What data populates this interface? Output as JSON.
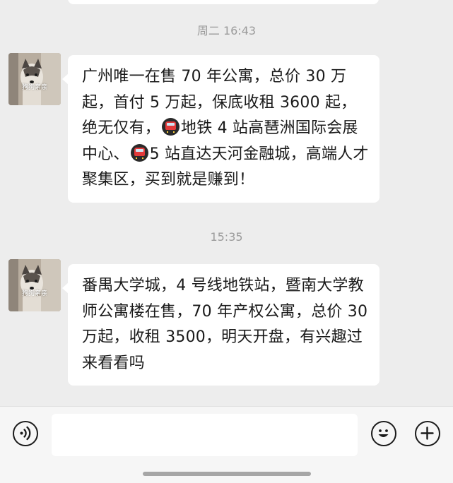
{
  "chat": {
    "messages": [
      {
        "time": "周二 16:43",
        "sender": "狗狗亲亲",
        "segments": [
          "广州唯一在售 70 年公寓，总价 30 万起，首付 5 万起，保底收租 3600 起，绝无仅有，",
          "地铁 4 站高琶洲国际会展中心、",
          "5 站直达天河金融城，高端人才聚集区，买到就是赚到！"
        ]
      },
      {
        "time": "15:35",
        "sender": "狗狗亲亲",
        "segments": [
          "番禺大学城，4 号线地铁站，暨南大学教师公寓楼在售，70 年产权公寓，总价 30 万起，收租 3500，明天开盘，有兴趣过来看看吗"
        ]
      }
    ]
  },
  "composer": {
    "input_value": "",
    "icons": [
      "voice-icon",
      "emoji-icon",
      "plus-icon"
    ]
  },
  "colors": {
    "background": "#ededed",
    "bubble": "#ffffff",
    "timestamp": "#9b9b9b",
    "text": "#1a1a1a",
    "metro_badge": "#e23a3a"
  }
}
